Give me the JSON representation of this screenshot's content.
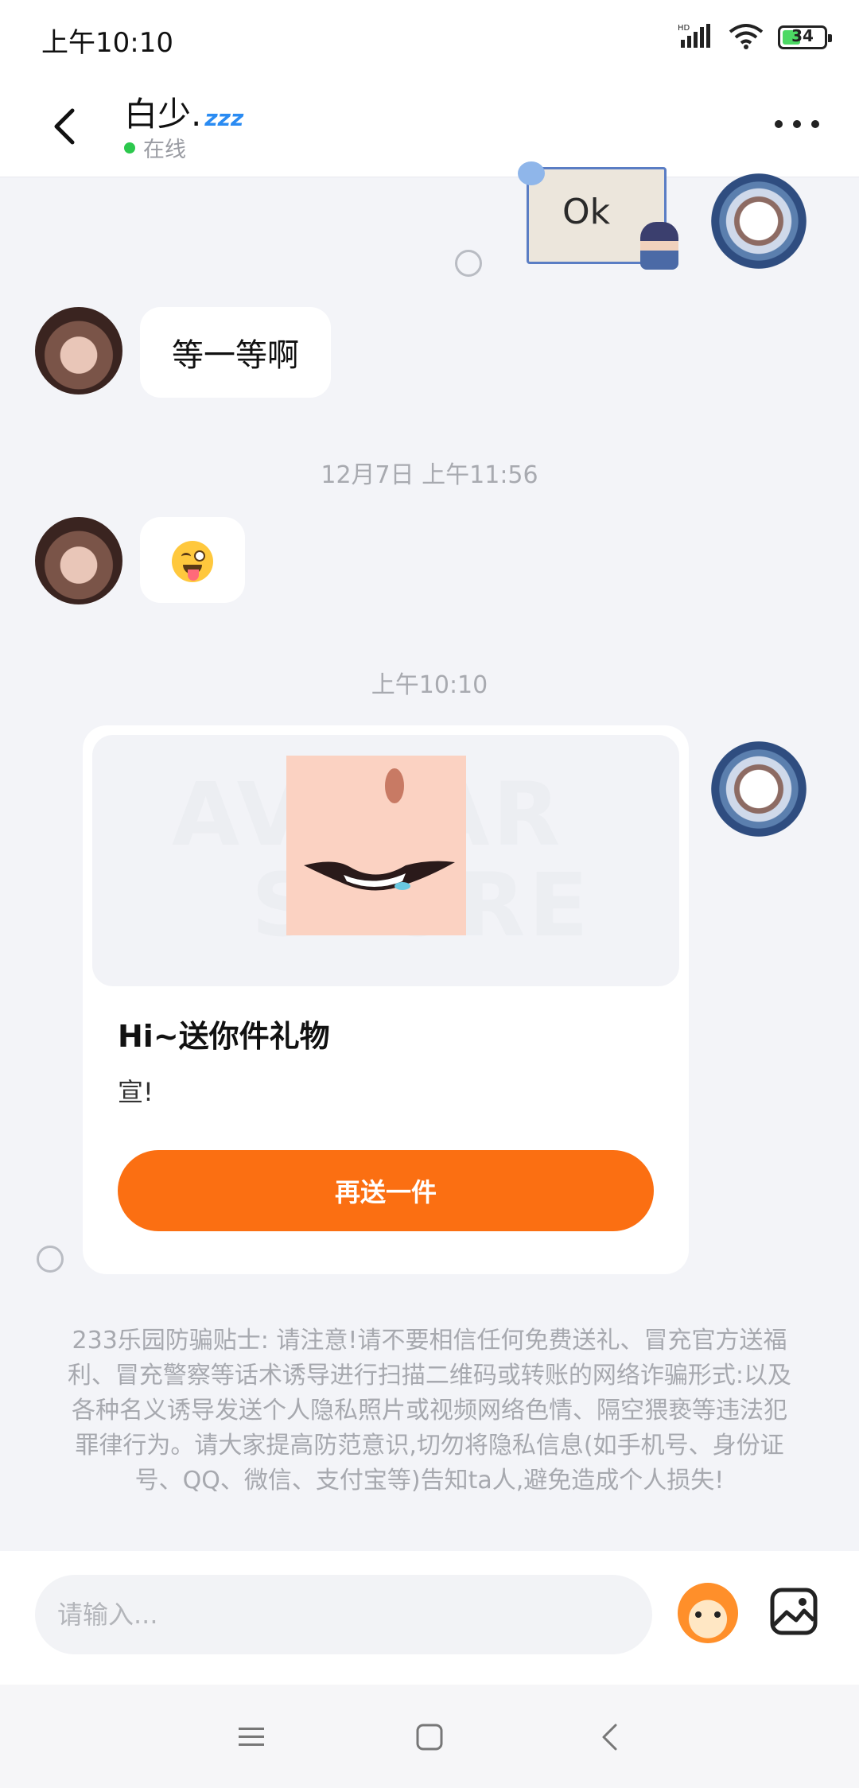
{
  "status_bar": {
    "time": "上午10:10",
    "network": "HD",
    "battery": "34"
  },
  "header": {
    "name": "白少.",
    "name_suffix": "zzz",
    "status": "在线"
  },
  "messages": {
    "sticker_text": "Ok",
    "text_1": "等一等啊",
    "timestamp_1": "12月7日 上午11:56",
    "emoji": "winking-tongue-face",
    "timestamp_2": "上午10:10"
  },
  "gift_card": {
    "watermark_line1": "AVATAR",
    "watermark_line2": "STORE",
    "title": "Hi~送你件礼物",
    "message": "宣!",
    "button": "再送一件"
  },
  "warning": "233乐园防骗贴士: 请注意!请不要相信任何免费送礼、冒充官方送福利、冒充警察等话术诱导进行扫描二维码或转账的网络诈骗形式:以及各种名义诱导发送个人隐私照片或视频网络色情、隔空猥亵等违法犯罪律行为。请大家提高防范意识,切勿将隐私信息(如手机号、身份证号、QQ、微信、支付宝等)告知ta人,避免造成个人损失!",
  "input": {
    "placeholder": "请输入..."
  },
  "colors": {
    "accent": "#fb6f12",
    "online": "#2cc84d",
    "background": "#f3f4f8"
  }
}
